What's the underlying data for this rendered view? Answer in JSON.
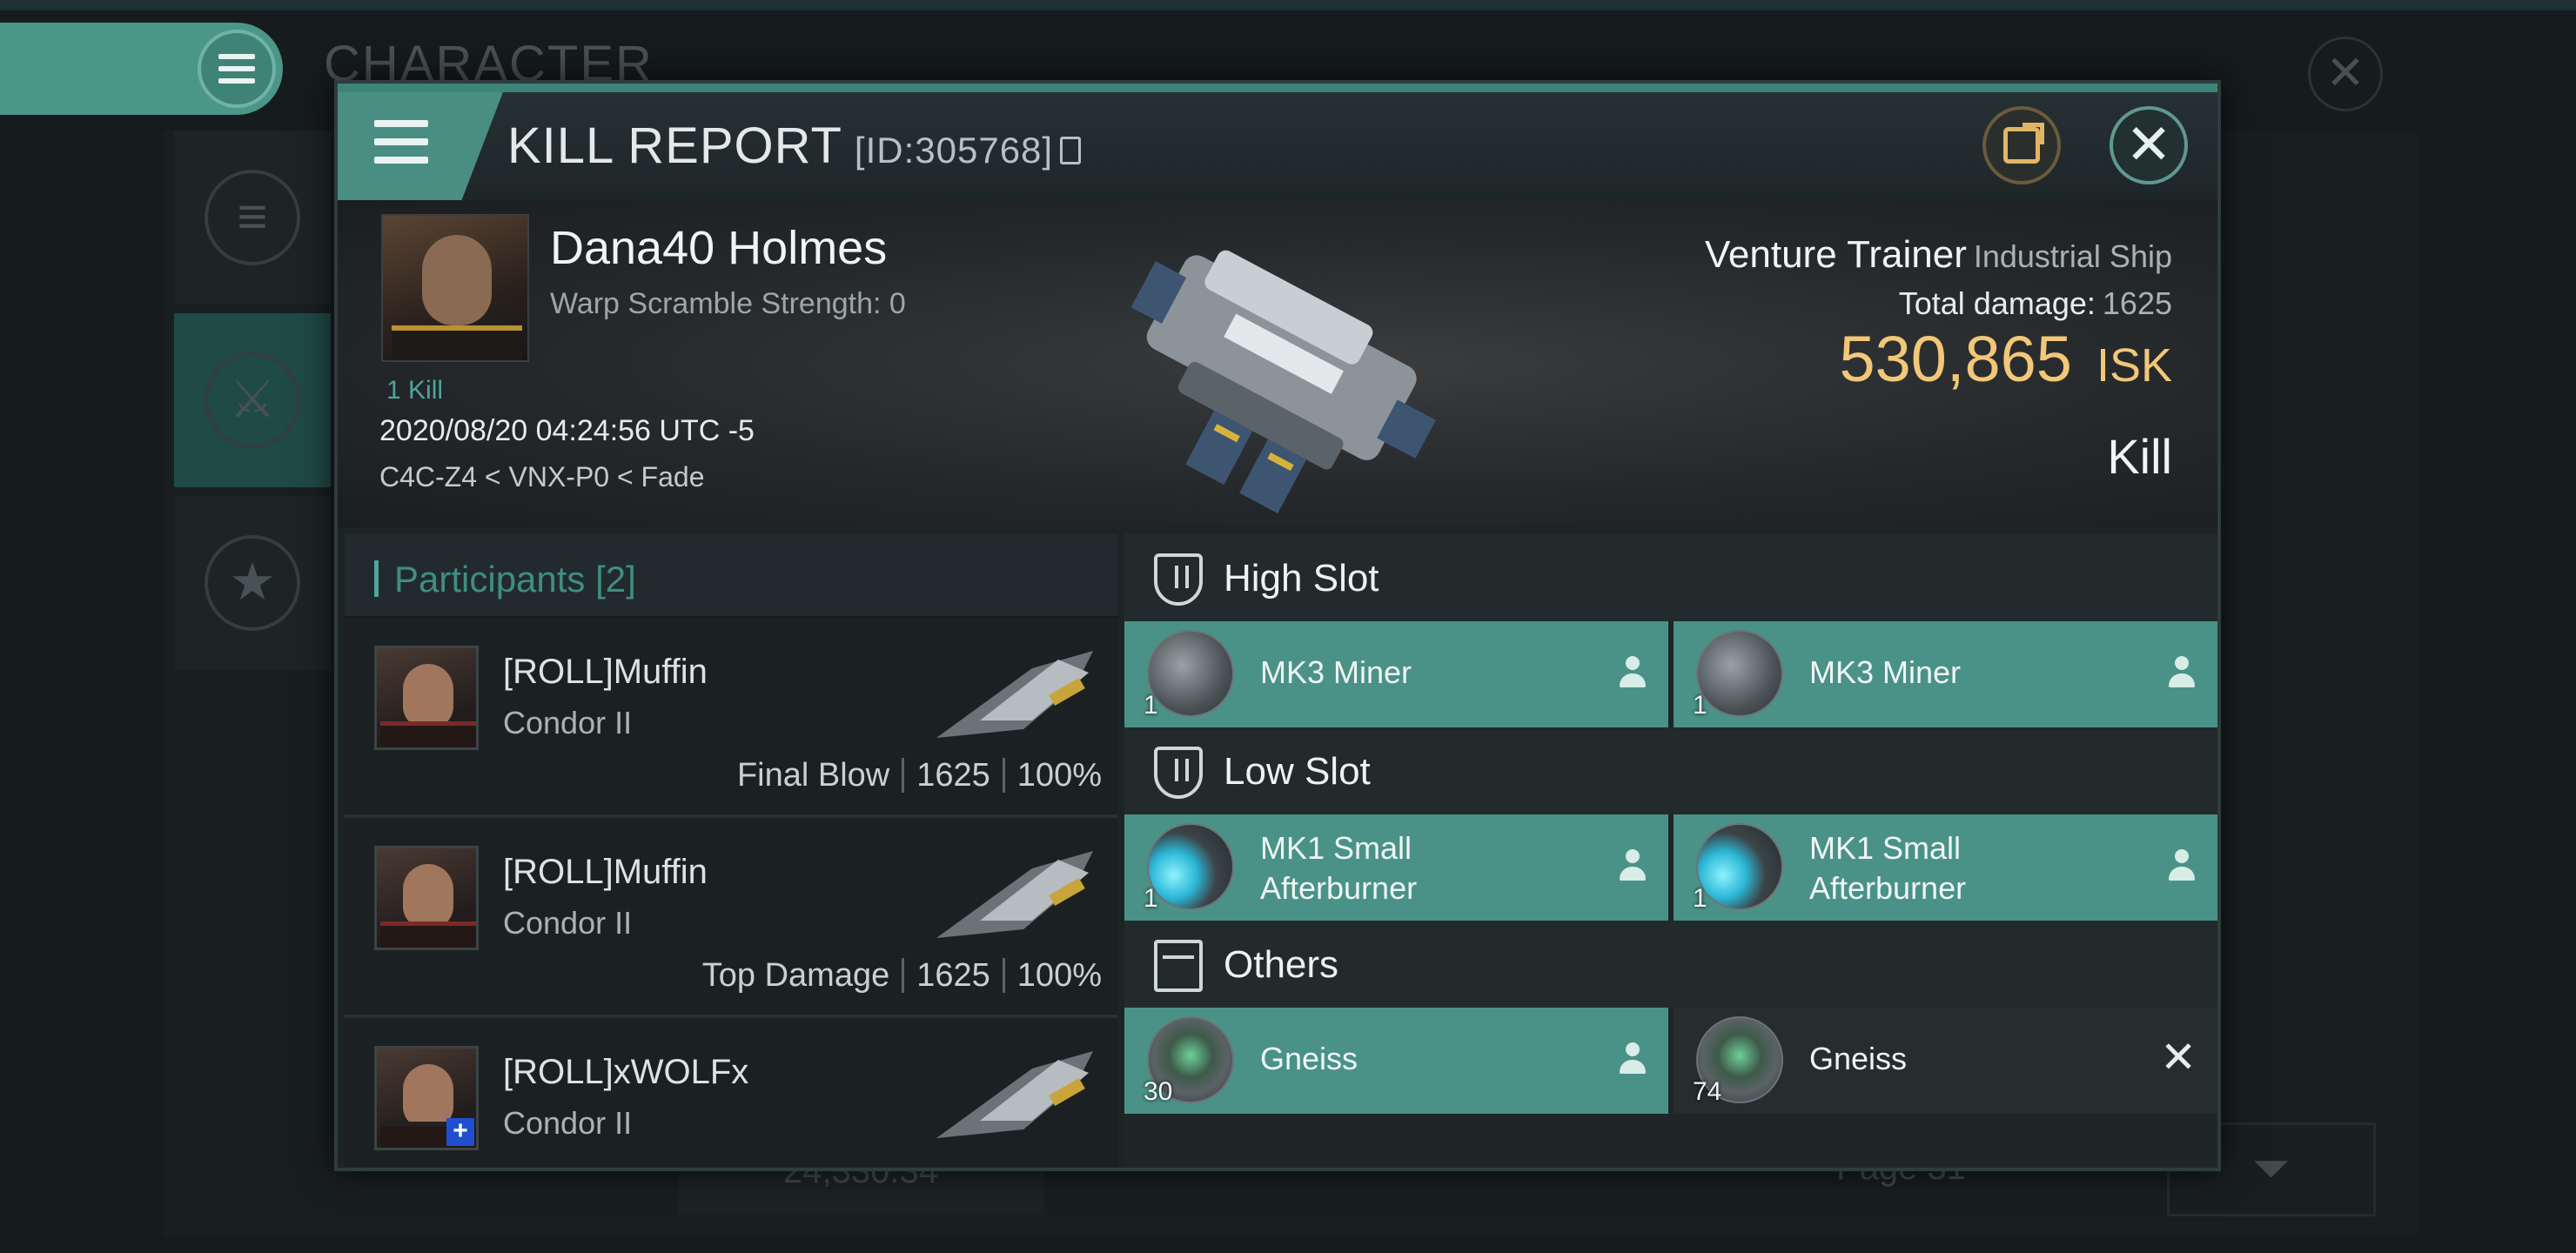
{
  "background": {
    "window_title": "CHARACTER",
    "bottom_value": "24,330.34",
    "page_label": "Page 31"
  },
  "modal": {
    "title": "KILL REPORT",
    "report_id": "[ID:305768]"
  },
  "victim": {
    "name": "Dana40 Holmes",
    "warp_scramble": "Warp Scramble Strength: 0",
    "kills": "1 Kill",
    "datetime": "2020/08/20 04:24:56 UTC -5",
    "location": "C4C-Z4 < VNX-P0 < Fade",
    "ship_name": "Venture Trainer",
    "ship_class": "Industrial Ship",
    "total_damage_label": "Total damage:",
    "total_damage": "1625",
    "isk_value": "530,865",
    "isk_unit": "ISK",
    "result": "Kill"
  },
  "participants": {
    "label": "Participants",
    "count": "[2]",
    "rows": [
      {
        "name": "[ROLL]Muffin",
        "ship": "Condor II",
        "role": "Final Blow",
        "damage": "1625",
        "percent": "100%"
      },
      {
        "name": "[ROLL]Muffin",
        "ship": "Condor II",
        "role": "Top Damage",
        "damage": "1625",
        "percent": "100%"
      },
      {
        "name": "[ROLL]xWOLFx",
        "ship": "Condor II"
      }
    ]
  },
  "fitting": {
    "high_slot_label": "High Slot",
    "low_slot_label": "Low Slot",
    "others_label": "Others",
    "high": [
      {
        "name": "MK3 Miner",
        "qty": "1"
      },
      {
        "name": "MK3 Miner",
        "qty": "1"
      }
    ],
    "low": [
      {
        "name": "MK1 Small Afterburner",
        "qty": "1"
      },
      {
        "name": "MK1 Small Afterburner",
        "qty": "1"
      }
    ],
    "others": [
      {
        "name": "Gneiss",
        "qty": "30",
        "status": "dropped"
      },
      {
        "name": "Gneiss",
        "qty": "74",
        "status": "destroyed"
      }
    ]
  },
  "colors": {
    "accent": "#4a9287",
    "isk": "#f2c778",
    "header_bar": "#3d8479"
  }
}
